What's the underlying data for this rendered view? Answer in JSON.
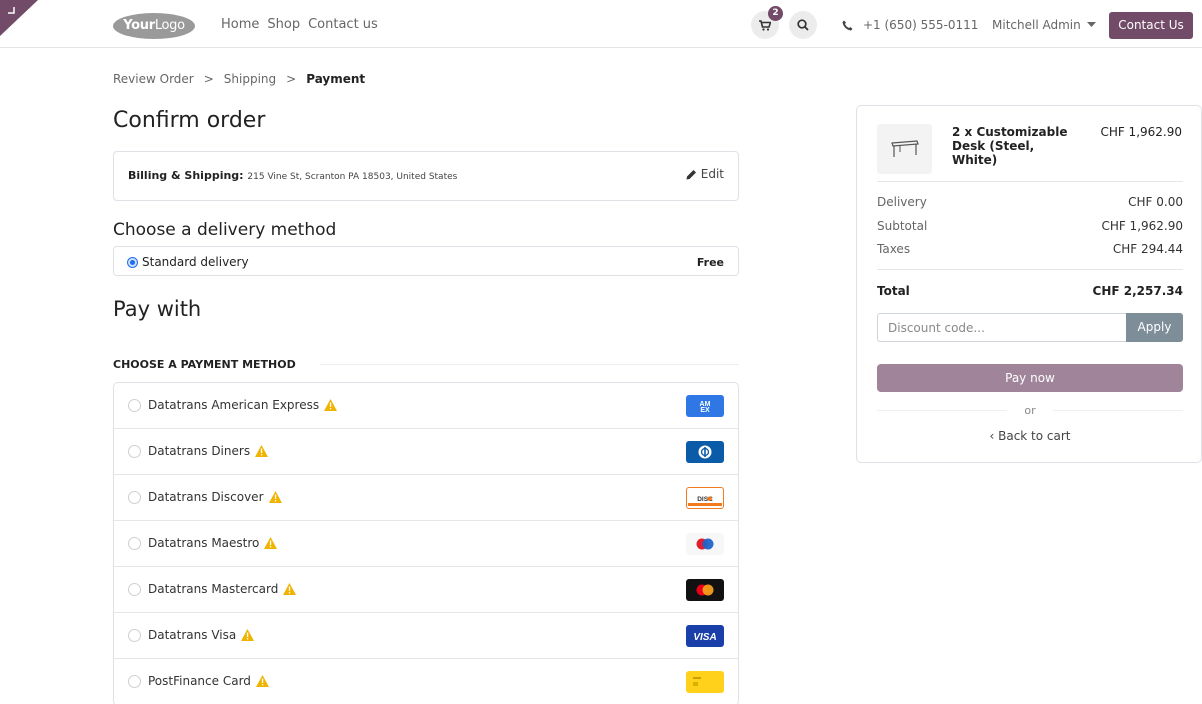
{
  "header": {
    "logo_text_bold": "Your",
    "logo_text": "Logo",
    "nav": [
      "Home",
      "Shop",
      "Contact us"
    ],
    "cart_count": "2",
    "phone": "+1 (650) 555-0111",
    "user": "Mitchell Admin",
    "contact_button": "Contact Us"
  },
  "breadcrumb": {
    "step1": "Review Order",
    "step2": "Shipping",
    "step3": "Payment",
    "separator": ">"
  },
  "main": {
    "title": "Confirm order",
    "billing_label": "Billing & Shipping:",
    "billing_address": "215 Vine St, Scranton PA 18503, United States",
    "edit_label": "Edit",
    "delivery_heading": "Choose a delivery method",
    "delivery_option": "Standard delivery",
    "delivery_price": "Free",
    "pay_heading": "Pay with",
    "payment_methods_heading": "CHOOSE A PAYMENT METHOD",
    "payment_methods": [
      {
        "name": "Datatrans American Express",
        "card": "amex-icon"
      },
      {
        "name": "Datatrans Diners",
        "card": "diners-icon"
      },
      {
        "name": "Datatrans Discover",
        "card": "discover-icon"
      },
      {
        "name": "Datatrans Maestro",
        "card": "maestro-icon"
      },
      {
        "name": "Datatrans Mastercard",
        "card": "mastercard-icon"
      },
      {
        "name": "Datatrans Visa",
        "card": "visa-icon"
      },
      {
        "name": "PostFinance Card",
        "card": "postfinance-icon"
      }
    ]
  },
  "summary": {
    "product_name": "2 x Customizable Desk (Steel, White)",
    "product_price": "CHF 1,962.90",
    "delivery_label": "Delivery",
    "delivery_value": "CHF 0.00",
    "subtotal_label": "Subtotal",
    "subtotal_value": "CHF 1,962.90",
    "taxes_label": "Taxes",
    "taxes_value": "CHF 294.44",
    "total_label": "Total",
    "total_value": "CHF 2,257.34",
    "discount_placeholder": "Discount code...",
    "apply_label": "Apply",
    "pay_now_label": "Pay now",
    "or_label": "or",
    "back_label": "Back to cart"
  },
  "colors": {
    "brand": "#714b67",
    "pay_button": "#a0859a",
    "apply_button": "#7d8e99",
    "warning": "#f0b400"
  }
}
